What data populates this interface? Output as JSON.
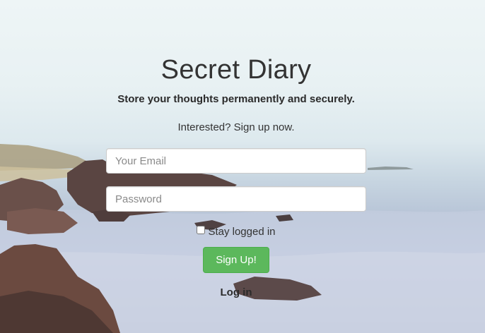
{
  "header": {
    "title": "Secret Diary",
    "subtitle": "Store your thoughts permanently and securely.",
    "cta_text": "Interested? Sign up now."
  },
  "form": {
    "email_placeholder": "Your Email",
    "email_value": "",
    "password_placeholder": "Password",
    "password_value": "",
    "remember_label": "Stay logged in",
    "remember_checked": false,
    "submit_label": "Sign Up!",
    "toggle_link_label": "Log in"
  },
  "colors": {
    "button_bg": "#5cb85c",
    "button_border": "#4cae4c",
    "text": "#333333"
  }
}
